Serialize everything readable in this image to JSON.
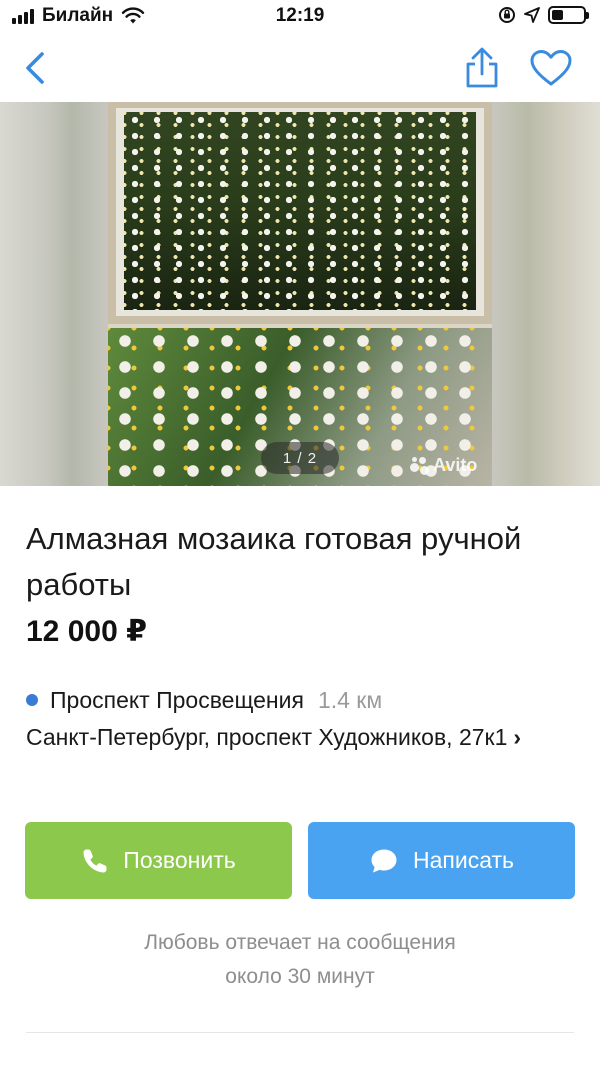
{
  "status_bar": {
    "carrier": "Билайн",
    "time": "12:19",
    "battery_level": 0.35
  },
  "nav": {
    "icons": [
      "chevron-left-icon",
      "share-icon",
      "heart-icon"
    ],
    "accent_color": "#3a8be0"
  },
  "gallery": {
    "counter": "1 / 2",
    "watermark": "Avito"
  },
  "listing": {
    "title": "Алмазная мозаика готовая ручной работы",
    "price": "12 000 ₽",
    "metro_station": "Проспект Просвещения",
    "metro_distance": "1.4 км",
    "metro_color": "#3a7bd5",
    "address": "Санкт-Петербург, проспект Художников, 27к1"
  },
  "actions": {
    "call_label": "Позвонить",
    "call_color": "#8cc84b",
    "message_label": "Написать",
    "message_color": "#4aa3f0"
  },
  "seller_note": {
    "line1": "Любовь отвечает на сообщения",
    "line2": "около 30 минут"
  }
}
